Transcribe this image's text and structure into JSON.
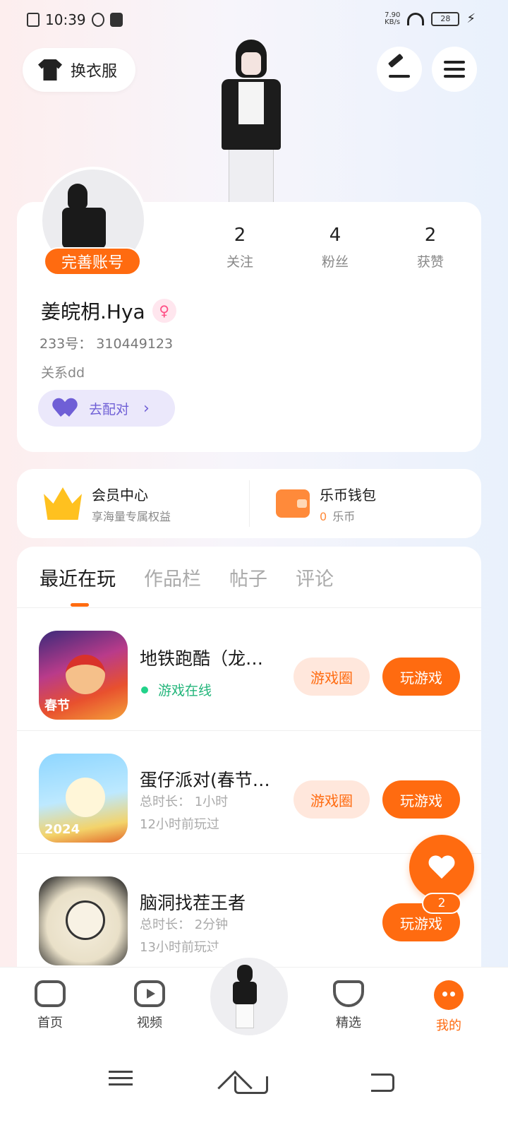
{
  "status_bar": {
    "time": "10:39",
    "battery": "28",
    "net_speed_top": "7.90",
    "net_speed_bottom": "KB/s"
  },
  "top_bar": {
    "outfit_label": "换衣服"
  },
  "profile": {
    "complete_badge": "完善账号",
    "stats": [
      {
        "num": "2",
        "label": "关注"
      },
      {
        "num": "4",
        "label": "粉丝"
      },
      {
        "num": "2",
        "label": "获赞"
      }
    ],
    "username": "姜皖枂.Hya",
    "gender_symbol": "♀",
    "user_id": "233号： 310449123",
    "bio": "关系dd",
    "pair_label": "去配对",
    "pair_chevron": "›"
  },
  "vip": {
    "member_title": "会员中心",
    "member_sub": "享海量专属权益",
    "wallet_title": "乐币钱包",
    "wallet_amount": "0",
    "wallet_unit": "乐币"
  },
  "tabs": [
    "最近在玩",
    "作品栏",
    "帖子",
    "评论"
  ],
  "games": [
    {
      "name": "地铁跑酷（龙…",
      "status": "游戏在线",
      "meta1": "",
      "meta2": "",
      "badge": "春节",
      "circle_label": "游戏圈",
      "play_label": "玩游戏"
    },
    {
      "name": "蛋仔派对(春节…",
      "status": "",
      "meta1": "总时长： 1小时",
      "meta2": "12小时前玩过",
      "badge": "2024",
      "circle_label": "游戏圈",
      "play_label": "玩游戏"
    },
    {
      "name": "脑洞找茬王者",
      "status": "",
      "meta1": "总时长： 2分钟",
      "meta2": "13小时前玩过",
      "badge": "",
      "circle_label": "",
      "play_label": "玩游戏"
    }
  ],
  "float_badge": "2",
  "bottom_nav": [
    {
      "label": "首页"
    },
    {
      "label": "视频"
    },
    {
      "label": "精选"
    },
    {
      "label": "我的"
    }
  ],
  "colors": {
    "accent": "#ff6b10",
    "online": "#22b57a",
    "pair": "#6f5fd6"
  }
}
